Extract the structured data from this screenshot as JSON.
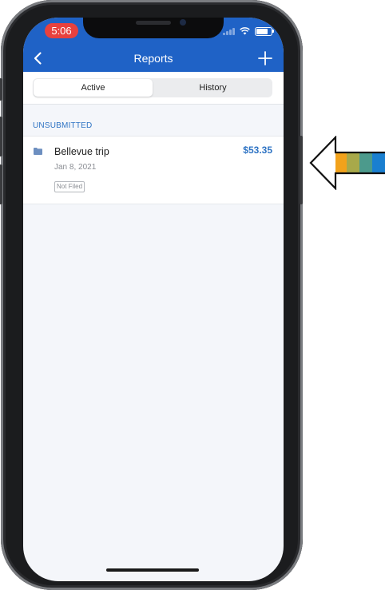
{
  "status_bar": {
    "time": "5:06"
  },
  "nav": {
    "title": "Reports"
  },
  "tabs": [
    {
      "label": "Active",
      "selected": true
    },
    {
      "label": "History",
      "selected": false
    }
  ],
  "section": {
    "label": "UNSUBMITTED"
  },
  "reports": [
    {
      "name": "Bellevue trip",
      "date": "Jan 8, 2021",
      "amount": "$53.35",
      "status": "Not Filed"
    }
  ],
  "icons": {
    "back": "chevron-left-icon",
    "add": "plus-icon",
    "folder": "folder-icon",
    "wifi": "wifi-icon",
    "battery": "battery-icon",
    "pointer": "arrow-left-icon"
  },
  "colors": {
    "header_bg": "#1f62c6",
    "accent": "#2f74c4",
    "time_pill": "#e8413e",
    "arrow_stripes": [
      "#f2a21b",
      "#a8a94a",
      "#4c9a8c",
      "#1a7fd0"
    ]
  }
}
